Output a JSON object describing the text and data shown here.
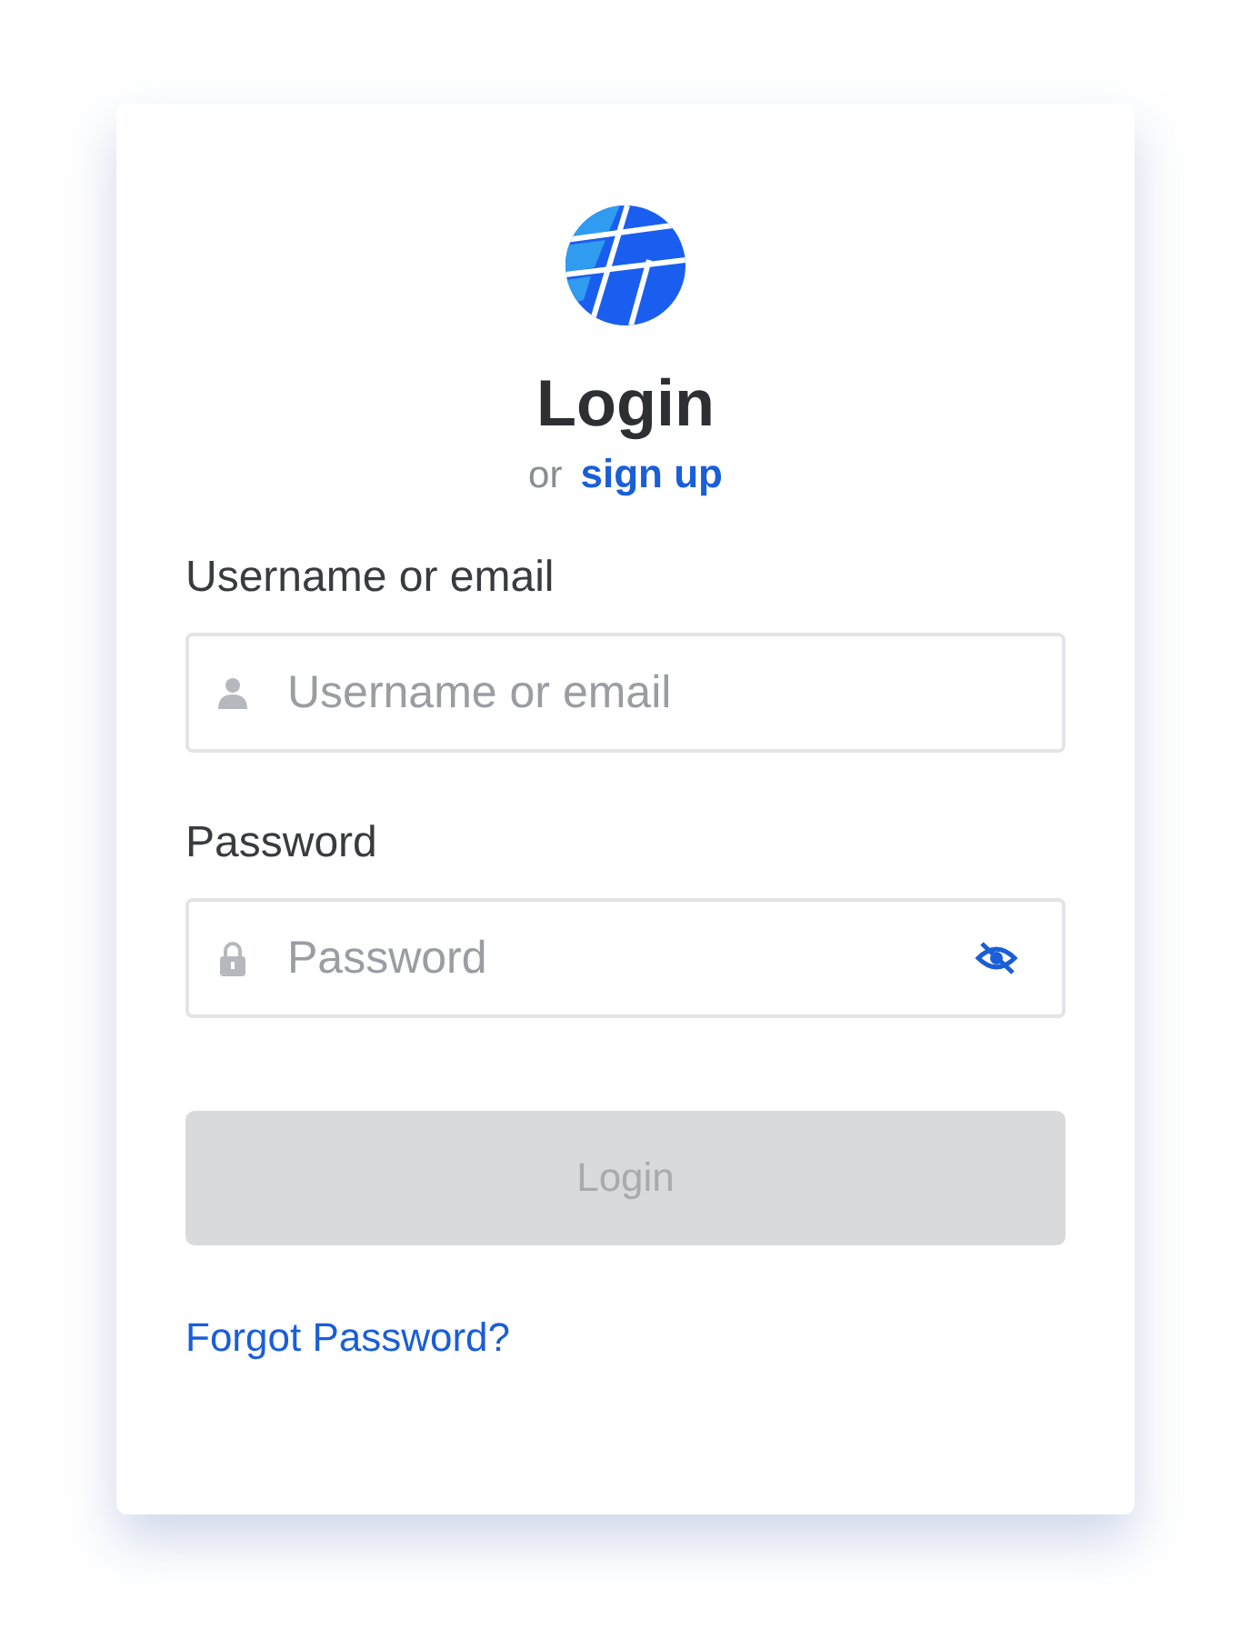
{
  "title": "Login",
  "signup": {
    "prefix": "or",
    "link": "sign up"
  },
  "fields": [
    {
      "kind": "text",
      "label": "Username or email",
      "placeholder": "Username or email"
    },
    {
      "kind": "password",
      "label": "Password",
      "placeholder": "Password",
      "password_visible": false
    }
  ],
  "submit": {
    "label": "Login",
    "disabled": true
  },
  "forgot_link": "Forgot Password?"
}
